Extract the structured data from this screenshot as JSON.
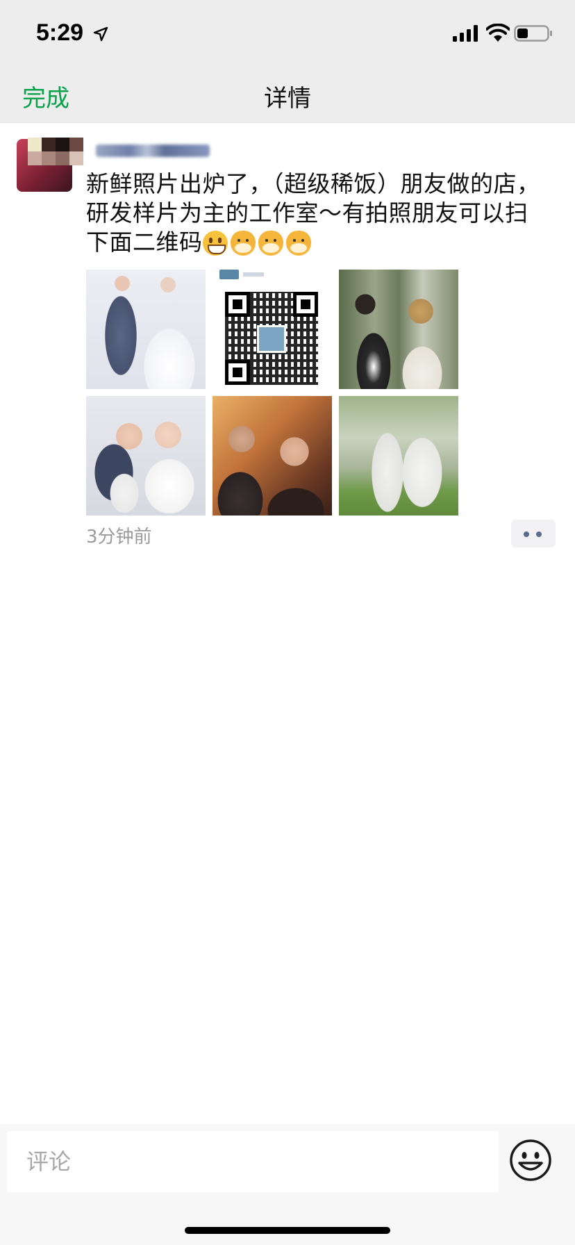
{
  "status_bar": {
    "time": "5:29",
    "icons": [
      "location-arrow-icon",
      "signal-icon",
      "wifi-icon",
      "battery-icon"
    ]
  },
  "nav": {
    "done_label": "完成",
    "title": "详情",
    "accent_color": "#07a34a"
  },
  "post": {
    "text_line1": "新鲜照片出炉了，（超级稀饭）朋友做的店，",
    "text_line2": "研发样片为主的工作室～有拍照朋友可以扫",
    "text_line3": "下面二维码",
    "emojis": [
      "grin-emoji",
      "cat-emoji",
      "cat-emoji",
      "cat-emoji"
    ],
    "timestamp": "3分钟前",
    "images": [
      "wedding-photo",
      "qr-code-image",
      "wedding-photo",
      "wedding-photo",
      "wedding-photo",
      "wedding-photo"
    ]
  },
  "comment": {
    "placeholder": "评论"
  }
}
